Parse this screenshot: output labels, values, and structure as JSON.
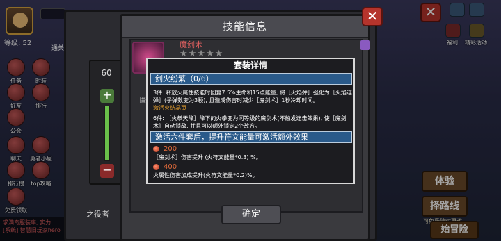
{
  "player": {
    "level": "等级: 52"
  },
  "side_buttons": [
    {
      "label": "任务"
    },
    {
      "label": "时装"
    },
    {
      "label": "好友"
    },
    {
      "label": "排行"
    },
    {
      "label": "公会"
    },
    {
      "label": "聊天"
    },
    {
      "label": "勇者小屋"
    },
    {
      "label": "排行榜"
    },
    {
      "label": "top攻略"
    },
    {
      "label": "免费领取"
    }
  ],
  "chat": {
    "line1": "求满奇服装率, 实力",
    "line2": "[系统] 智慧旧玩家hero"
  },
  "right_bar": {
    "icon_label_1": "福利",
    "icon_label_2": "精彩活动",
    "button_1": "体验",
    "button_2": "择路线",
    "footer": "可免费随时更改",
    "bottom_text": "始冒险"
  },
  "skill_dialog": {
    "title": "技能信息",
    "skill_name": "魔剑术",
    "stars": "★★★★★",
    "desc_fragment": "描述",
    "confirm": "确定"
  },
  "under_panel": {
    "slider_value": "60",
    "plus": "+",
    "minus": "−",
    "hint": "通关",
    "caption": "之役者"
  },
  "set_popup": {
    "title": "套装详情",
    "set_name": "剑火纷繁（0/6）",
    "tier3_text": "3件: 释放火属性技能时回复7.5%生命和15点能量, 将［火焰弹］强化为［火焰连弹］(子弹数变为3颗), 且造成伤害时减少［魔剑术］1秒冷却时间。",
    "tier3_activate": "激活火结晶页",
    "tier6_text": "6件: ［火拳天降］降下的火拳变为同等级的魔剑术(不触发连击效果), 使［魔剑术］自动锁敌, 并且可以额外锁定2个敌方。",
    "bonus_title": "激活六件套后，提升符文能量可激活额外效果",
    "bonus1_value": "200",
    "bonus1_text": "［魔剑术］伤害提升 (火符文能量*0.3) %。",
    "bonus2_value": "400",
    "bonus2_text": "火属性伤害加成提升(火符文能量*0.2)%。"
  },
  "icons": [
    "avatar",
    "close-icon",
    "gem-icon",
    "star-icon",
    "plus-icon",
    "minus-icon"
  ]
}
